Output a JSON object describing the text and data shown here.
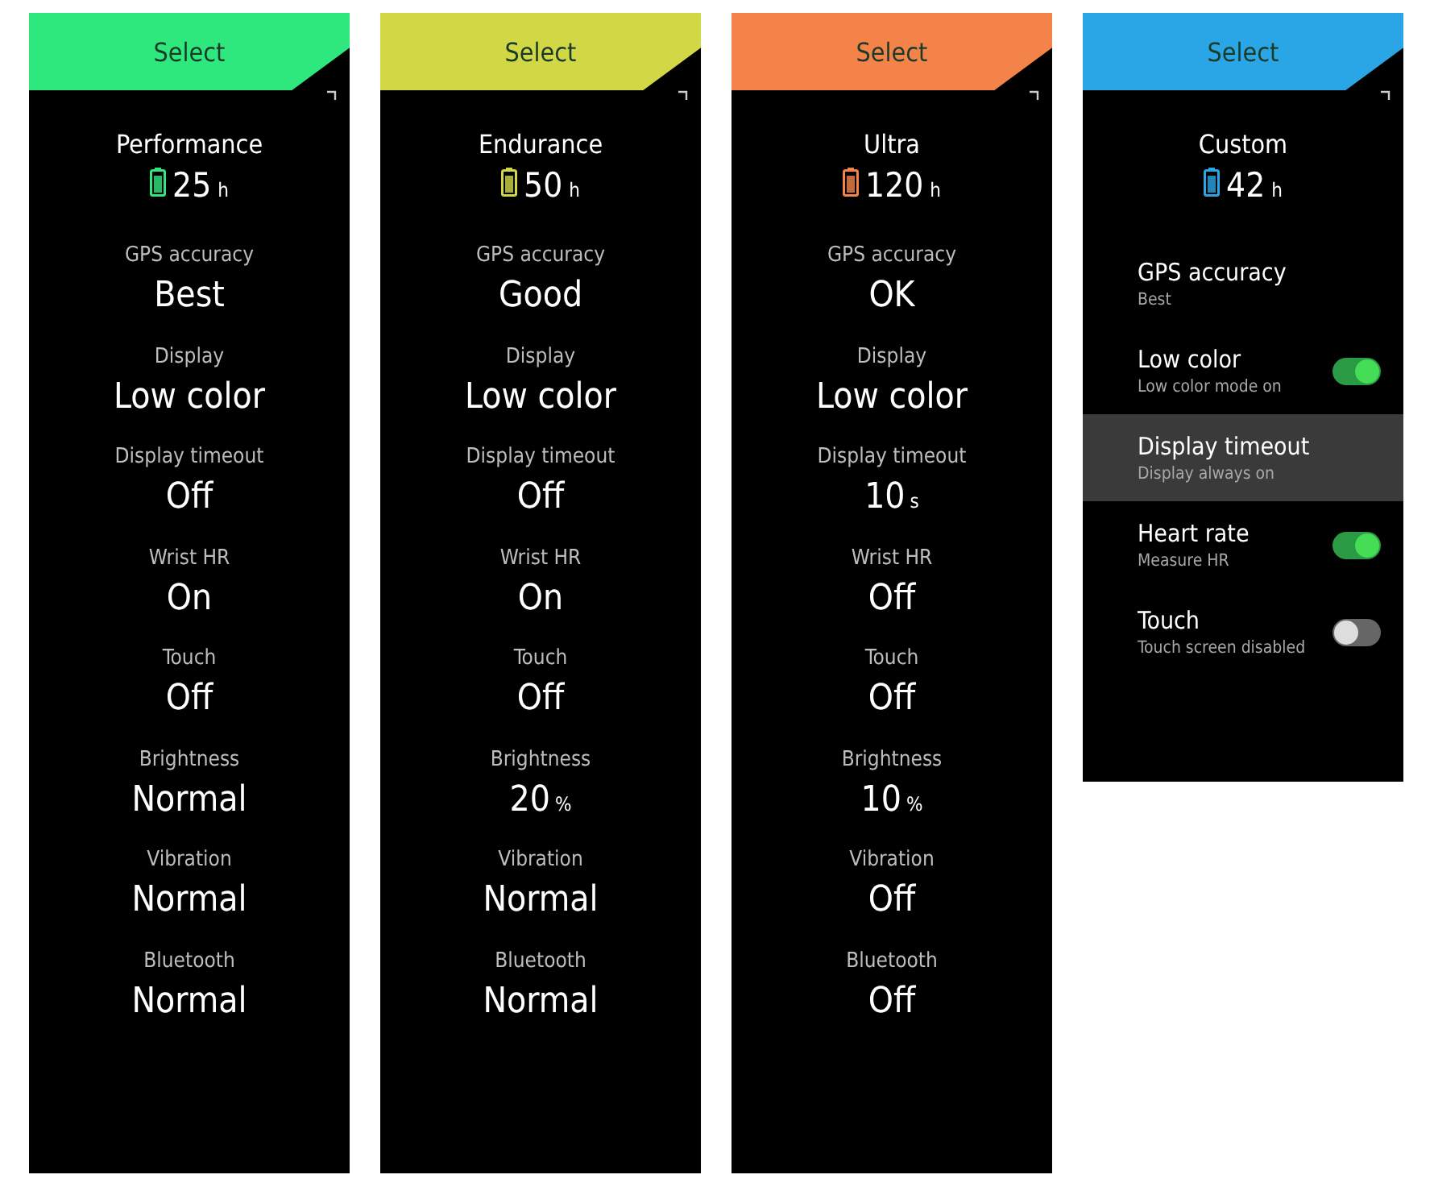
{
  "screens": [
    {
      "kind": "summary",
      "header": "Select",
      "color": "#2ee87e",
      "name": "Performance",
      "hours": "25",
      "hours_unit": "h",
      "settings": [
        {
          "label": "GPS accuracy",
          "value": "Best"
        },
        {
          "label": "Display",
          "value": "Low color"
        },
        {
          "label": "Display timeout",
          "value": "Off"
        },
        {
          "label": "Wrist HR",
          "value": "On"
        },
        {
          "label": "Touch",
          "value": "Off"
        },
        {
          "label": "Brightness",
          "value": "Normal"
        },
        {
          "label": "Vibration",
          "value": "Normal"
        },
        {
          "label": "Bluetooth",
          "value": "Normal"
        }
      ]
    },
    {
      "kind": "summary",
      "header": "Select",
      "color": "#d2d845",
      "name": "Endurance",
      "hours": "50",
      "hours_unit": "h",
      "settings": [
        {
          "label": "GPS accuracy",
          "value": "Good"
        },
        {
          "label": "Display",
          "value": "Low color"
        },
        {
          "label": "Display timeout",
          "value": "Off"
        },
        {
          "label": "Wrist HR",
          "value": "On"
        },
        {
          "label": "Touch",
          "value": "Off"
        },
        {
          "label": "Brightness",
          "value": "20",
          "unit": "%"
        },
        {
          "label": "Vibration",
          "value": "Normal"
        },
        {
          "label": "Bluetooth",
          "value": "Normal"
        }
      ]
    },
    {
      "kind": "summary",
      "header": "Select",
      "color": "#f4834a",
      "name": "Ultra",
      "hours": "120",
      "hours_unit": "h",
      "settings": [
        {
          "label": "GPS accuracy",
          "value": "OK"
        },
        {
          "label": "Display",
          "value": "Low color"
        },
        {
          "label": "Display timeout",
          "value": "10",
          "unit": "s"
        },
        {
          "label": "Wrist HR",
          "value": "Off"
        },
        {
          "label": "Touch",
          "value": "Off"
        },
        {
          "label": "Brightness",
          "value": "10",
          "unit": "%"
        },
        {
          "label": "Vibration",
          "value": "Off"
        },
        {
          "label": "Bluetooth",
          "value": "Off"
        }
      ]
    },
    {
      "kind": "custom",
      "header": "Select",
      "color": "#2aa6e6",
      "name": "Custom",
      "hours": "42",
      "hours_unit": "h",
      "settings": [
        {
          "kind": "plain",
          "title": "GPS accuracy",
          "subtitle": "Best",
          "selected": false
        },
        {
          "kind": "toggle",
          "title": "Low color",
          "subtitle": "Low color mode on",
          "on": true,
          "selected": false
        },
        {
          "kind": "plain",
          "title": "Display timeout",
          "subtitle": "Display always on",
          "selected": true
        },
        {
          "kind": "toggle",
          "title": "Heart rate",
          "subtitle": "Measure HR",
          "on": true,
          "selected": false
        },
        {
          "kind": "toggle",
          "title": "Touch",
          "subtitle": "Touch screen disabled",
          "on": false,
          "selected": false
        }
      ]
    }
  ]
}
